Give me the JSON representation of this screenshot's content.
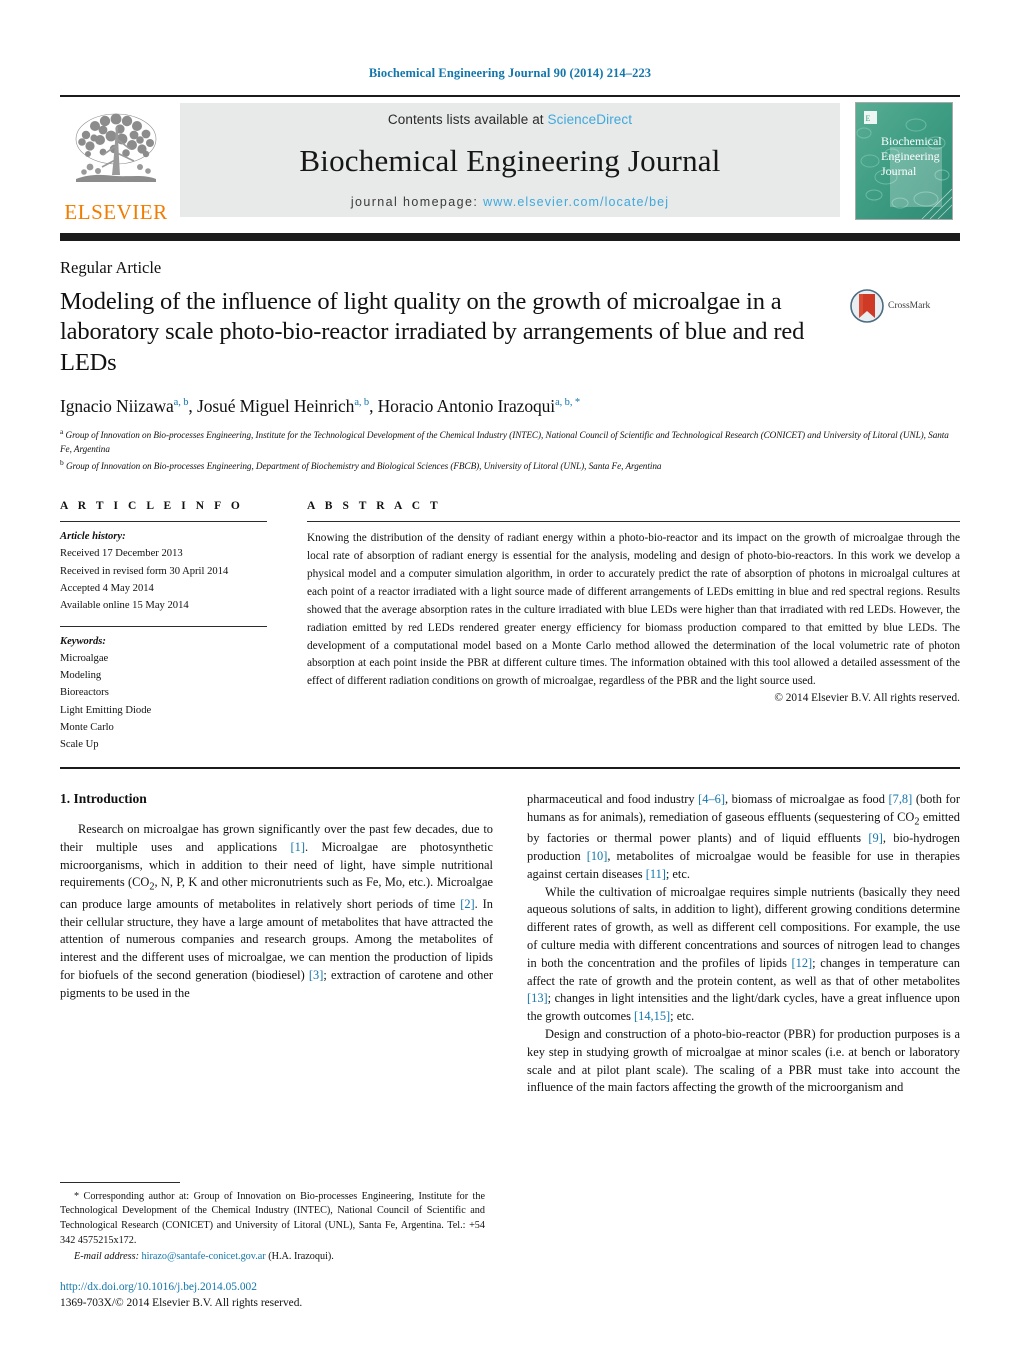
{
  "running_head": "Biochemical Engineering Journal 90 (2014) 214–223",
  "masthead": {
    "publisher_name": "ELSEVIER",
    "contents_prefix": "Contents lists available at ",
    "contents_link": "ScienceDirect",
    "journal_title": "Biochemical Engineering Journal",
    "homepage_prefix": "journal homepage: ",
    "homepage_url": "www.elsevier.com/locate/bej",
    "cover_title_line1": "Biochemical",
    "cover_title_line2": "Engineering",
    "cover_title_line3": "Journal"
  },
  "article": {
    "type": "Regular Article",
    "title": "Modeling of the influence of light quality on the growth of microalgae in a laboratory scale photo-bio-reactor irradiated by arrangements of blue and red LEDs",
    "crossmark_label": "CrossMark",
    "authors_html": "Ignacio Niizawa, Josué Miguel Heinrich, Horacio Antonio Irazoqui",
    "authors": [
      {
        "name": "Ignacio Niizawa",
        "marks": "a, b"
      },
      {
        "name": "Josué Miguel Heinrich",
        "marks": "a, b"
      },
      {
        "name": "Horacio Antonio Irazoqui",
        "marks": "a, b, *"
      }
    ],
    "affiliation_a": "Group of Innovation on Bio-processes Engineering, Institute for the Technological Development of the Chemical Industry (INTEC), National Council of Scientific and Technological Research (CONICET) and University of Litoral (UNL), Santa Fe, Argentina",
    "affiliation_b": "Group of Innovation on Bio-processes Engineering, Department of Biochemistry and Biological Sciences (FBCB), University of Litoral (UNL), Santa Fe, Argentina"
  },
  "article_info": {
    "heading": "A R T I C L E   I N F O",
    "history_label": "Article history:",
    "history": [
      "Received 17 December 2013",
      "Received in revised form 30 April 2014",
      "Accepted 4 May 2014",
      "Available online 15 May 2014"
    ],
    "keywords_label": "Keywords:",
    "keywords": [
      "Microalgae",
      "Modeling",
      "Bioreactors",
      "Light Emitting Diode",
      "Monte Carlo",
      "Scale Up"
    ]
  },
  "abstract": {
    "heading": "A B S T R A C T",
    "text": "Knowing the distribution of the density of radiant energy within a photo-bio-reactor and its impact on the growth of microalgae through the local rate of absorption of radiant energy is essential for the analysis, modeling and design of photo-bio-reactors. In this work we develop a physical model and a computer simulation algorithm, in order to accurately predict the rate of absorption of photons in microalgal cultures at each point of a reactor irradiated with a light source made of different arrangements of LEDs emitting in blue and red spectral regions. Results showed that the average absorption rates in the culture irradiated with blue LEDs were higher than that irradiated with red LEDs. However, the radiation emitted by red LEDs rendered greater energy efficiency for biomass production compared to that emitted by blue LEDs. The development of a computational model based on a Monte Carlo method allowed the determination of the local volumetric rate of photon absorption at each point inside the PBR at different culture times. The information obtained with this tool allowed a detailed assessment of the effect of different radiation conditions on growth of microalgae, regardless of the PBR and the light source used.",
    "copyright": "© 2014 Elsevier B.V. All rights reserved."
  },
  "introduction": {
    "heading": "1.  Introduction",
    "left_paragraph_1_a": "Research on microalgae has grown significantly over the past few decades, due to their multiple uses and applications ",
    "ref1": "[1]",
    "left_paragraph_1_b": ". Microalgae are photosynthetic microorganisms, which in addition to their need of light, have simple nutritional requirements (CO",
    "left_paragraph_1_c": ", N, P, K and other micronutrients such as Fe, Mo, etc.). Microalgae can produce large amounts of metabolites in relatively short periods of time ",
    "ref2": "[2]",
    "left_paragraph_1_d": ". In their cellular structure, they have a large amount of metabolites that have attracted the attention of numerous companies and research groups. Among the metabolites of interest and the different uses of microalgae, we can mention the production of lipids for biofuels of the second generation (biodiesel) ",
    "ref3": "[3]",
    "left_paragraph_1_e": "; extraction of carotene and other pigments to be used in the ",
    "right_paragraph_1_a": "pharmaceutical and food industry ",
    "ref46": "[4–6]",
    "right_paragraph_1_b": ", biomass of microalgae as food ",
    "ref78": "[7,8]",
    "right_paragraph_1_c": " (both for humans as for animals), remediation of gaseous effluents (sequestering of CO",
    "right_paragraph_1_d": " emitted by factories or thermal power plants) and of liquid effluents ",
    "ref9": "[9]",
    "right_paragraph_1_e": ", bio-hydrogen production ",
    "ref10": "[10]",
    "right_paragraph_1_f": ", metabolites of microalgae would be feasible for use in therapies against certain diseases ",
    "ref11": "[11]",
    "right_paragraph_1_g": "; etc.",
    "right_paragraph_2_a": "While the cultivation of microalgae requires simple nutrients (basically they need aqueous solutions of salts, in addition to light), different growing conditions determine different rates of growth, as well as different cell compositions. For example, the use of culture media with different concentrations and sources of nitrogen lead to changes in both the concentration and the profiles of lipids ",
    "ref12": "[12]",
    "right_paragraph_2_b": "; changes in temperature can affect the rate of growth and the protein content, as well as that of other metabolites ",
    "ref13": "[13]",
    "right_paragraph_2_c": "; changes in light intensities and the light/dark cycles, have a great influence upon the growth outcomes ",
    "ref1415": "[14,15]",
    "right_paragraph_2_d": "; etc.",
    "right_paragraph_3": "Design and construction of a photo-bio-reactor (PBR) for production purposes is a key step in studying growth of microalgae at minor scales (i.e. at bench or laboratory scale and at pilot plant scale). The scaling of a PBR must take into account the influence of the main factors affecting the growth of the microorganism and"
  },
  "footer": {
    "corresponding_marker": "*",
    "corresponding_text": "Corresponding author at: Group of Innovation on Bio-processes Engineering, Institute for the Technological Development of the Chemical Industry (INTEC), National Council of Scientific and Technological Research (CONICET) and University of Litoral (UNL), Santa Fe, Argentina. Tel.: +54 342 4575215x172.",
    "email_label": "E-mail address:",
    "email": "hirazo@santafe-conicet.gov.ar",
    "email_suffix": "(H.A. Irazoqui).",
    "doi": "http://dx.doi.org/10.1016/j.bej.2014.05.002",
    "issn_line": "1369-703X/© 2014 Elsevier B.V. All rights reserved."
  },
  "colors": {
    "link_blue": "#1276ab",
    "sciencedirect_blue": "#3fa9dd",
    "elsevier_orange": "#f07c00",
    "masthead_grey": "#e8e9e9",
    "rule_black": "#1b1b1b"
  }
}
